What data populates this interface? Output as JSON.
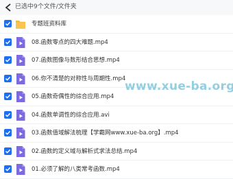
{
  "header": {
    "title": "已选中9个文件/文件夹"
  },
  "items": [
    {
      "name": "专题班资料库",
      "type": "folder"
    },
    {
      "name": "08.函数零点的四大难题.mp4",
      "type": "video"
    },
    {
      "name": "07.函数图像与数形结合思想.mp4",
      "type": "video"
    },
    {
      "name": "06.你不清楚的对称性与周期性.mp4",
      "type": "video"
    },
    {
      "name": "05.函数奇偶性的综合应用.mp4",
      "type": "video"
    },
    {
      "name": "04.函数单调性的综合应用.avi",
      "type": "video"
    },
    {
      "name": "03.函数值域解法梳理【学霸网www.xue-ba.org】.mp4",
      "type": "video"
    },
    {
      "name": "02.函数的定义域与解析式求法总结.mp4",
      "type": "video"
    },
    {
      "name": "01.必须了解的八类常考函数.mp4",
      "type": "video"
    }
  ],
  "watermark": "www.xue-ba.org",
  "colors": {
    "accent": "#1e6ff0",
    "folder": "#f7b93b",
    "video_icon": "#7b6ae0",
    "header_bg": "#f7f8fa"
  }
}
